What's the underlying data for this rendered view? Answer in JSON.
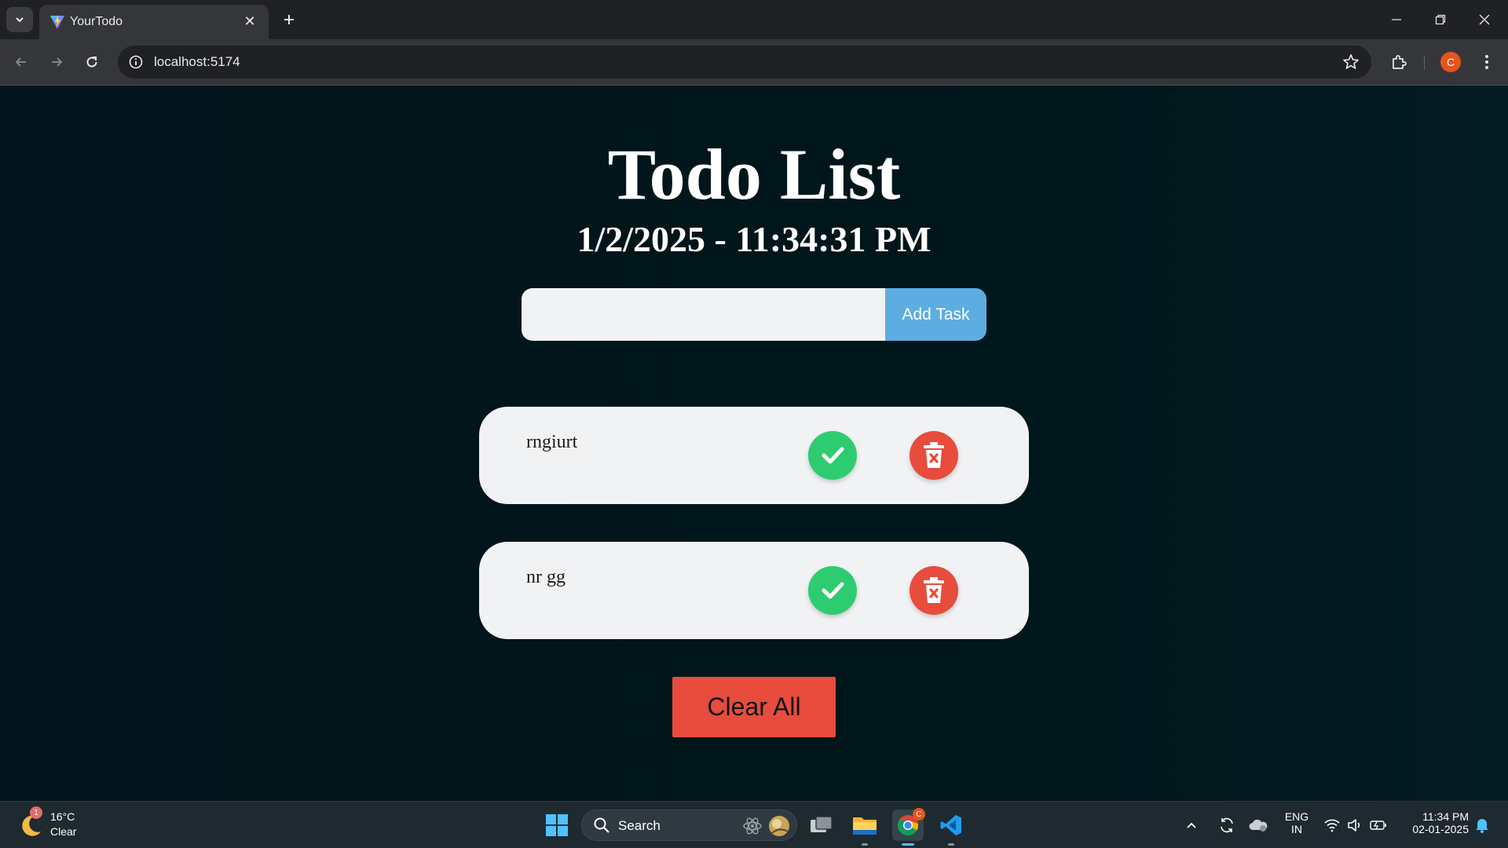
{
  "browser": {
    "tab_title": "YourTodo",
    "url": "localhost:5174",
    "profile_initial": "C"
  },
  "app": {
    "title": "Todo List",
    "datetime": "1/2/2025 - 11:34:31 PM",
    "input_value": "",
    "add_button_label": "Add Task",
    "todos": [
      {
        "text": "rngiurt"
      },
      {
        "text": "nr gg"
      }
    ],
    "clear_all_label": "Clear All",
    "colors": {
      "check": "#2ecc71",
      "delete": "#e74c3c",
      "add_button": "#5dade2"
    }
  },
  "taskbar": {
    "weather_badge": "1",
    "weather_temp": "16°C",
    "weather_cond": "Clear",
    "search_label": "Search",
    "chrome_badge": "C",
    "lang_top": "ENG",
    "lang_bottom": "IN",
    "time": "11:34 PM",
    "date": "02-01-2025"
  }
}
